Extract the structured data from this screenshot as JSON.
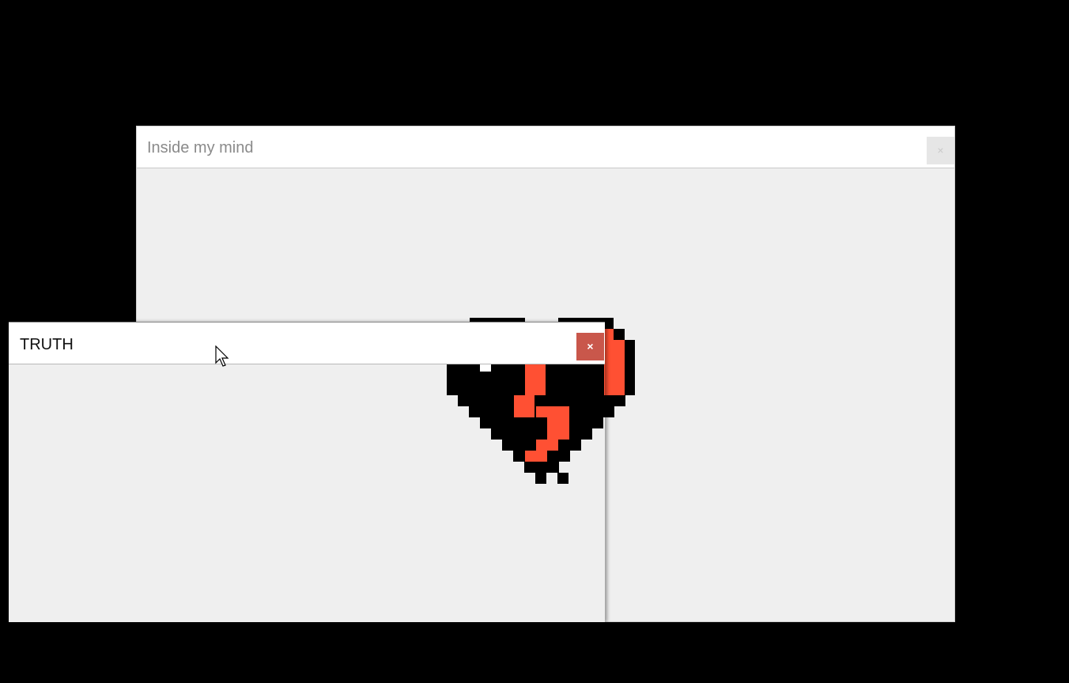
{
  "main_window": {
    "title": "Inside my mind",
    "close_label": "×"
  },
  "truth_window": {
    "title": "TRUTH",
    "close_label": "×"
  },
  "colors": {
    "desktop_bg": "#000000",
    "window_bg": "#efefef",
    "close_active": "#c9574b",
    "heart_red": "#ff5033",
    "heart_black": "#000000"
  },
  "icons": {
    "heart": "broken-pixel-heart-icon",
    "cursor": "mouse-pointer-icon"
  }
}
